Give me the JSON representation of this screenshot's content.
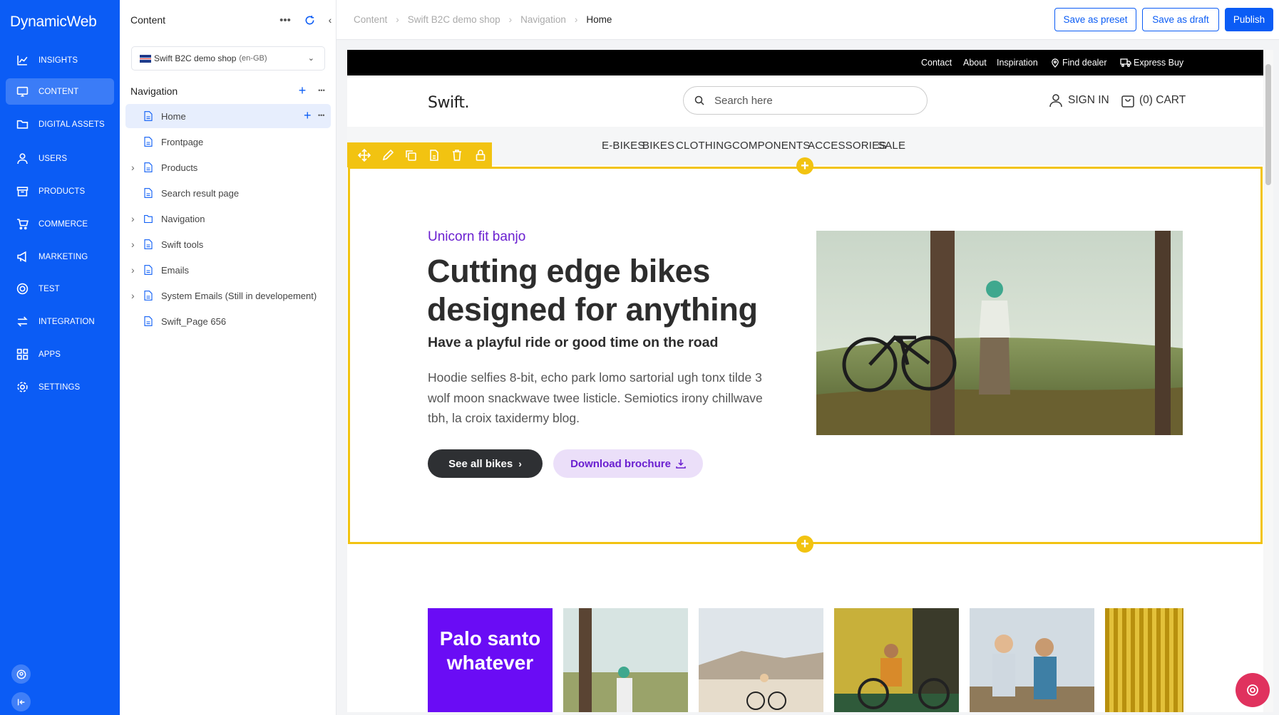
{
  "app": {
    "brand": "DynamicWeb"
  },
  "nav": {
    "items": [
      {
        "label": "INSIGHTS",
        "icon": "chart-line-icon"
      },
      {
        "label": "CONTENT",
        "icon": "monitor-icon"
      },
      {
        "label": "DIGITAL ASSETS",
        "icon": "folder-icon"
      },
      {
        "label": "USERS",
        "icon": "user-icon"
      },
      {
        "label": "PRODUCTS",
        "icon": "box-icon"
      },
      {
        "label": "COMMERCE",
        "icon": "cart-icon"
      },
      {
        "label": "MARKETING",
        "icon": "megaphone-icon"
      },
      {
        "label": "TEST",
        "icon": "target-icon"
      },
      {
        "label": "INTEGRATION",
        "icon": "arrows-icon"
      },
      {
        "label": "APPS",
        "icon": "grid-icon"
      },
      {
        "label": "SETTINGS",
        "icon": "gear-icon"
      }
    ],
    "active": "CONTENT"
  },
  "tree": {
    "title": "Content",
    "area": {
      "name": "Swift B2C demo shop",
      "locale": "(en-GB)"
    },
    "section": "Navigation",
    "rows": [
      {
        "label": "Home",
        "expandable": false,
        "selected": true,
        "type": "page"
      },
      {
        "label": "Frontpage",
        "expandable": false,
        "type": "page"
      },
      {
        "label": "Products",
        "expandable": true,
        "type": "page"
      },
      {
        "label": "Search result page",
        "expandable": false,
        "type": "page"
      },
      {
        "label": "Navigation",
        "expandable": true,
        "type": "folder"
      },
      {
        "label": "Swift tools",
        "expandable": true,
        "type": "page"
      },
      {
        "label": "Emails",
        "expandable": true,
        "type": "page"
      },
      {
        "label": "System Emails (Still in developement)",
        "expandable": true,
        "type": "page"
      },
      {
        "label": "Swift_Page 656",
        "expandable": false,
        "type": "page"
      }
    ]
  },
  "topbar": {
    "breadcrumb": [
      "Content",
      "Swift B2C demo shop",
      "Navigation",
      "Home"
    ],
    "buttons": {
      "preset": "Save as preset",
      "draft": "Save as draft",
      "publish": "Publish"
    }
  },
  "site": {
    "utility_links": [
      "Contact",
      "About",
      "Inspiration",
      "Find dealer",
      "Express Buy"
    ],
    "logo": "Swift.",
    "search_placeholder": "Search here",
    "sign_in": "SIGN IN",
    "cart": "(0) CART",
    "menu": [
      "E-BIKES",
      "BIKES",
      "CLOTHING",
      "COMPONENTS",
      "ACCESSORIES",
      "SALE"
    ],
    "hero": {
      "eyebrow": "Unicorn fit banjo",
      "title": "Cutting edge bikes designed for anything",
      "subtitle": "Have a playful ride or good time on the road",
      "body": "Hoodie selfies 8-bit, echo park lomo sartorial ugh tonx tilde 3 wolf moon snackwave twee listicle. Semiotics irony chillwave tbh, la croix taxidermy blog.",
      "cta_primary": "See all bikes",
      "cta_secondary": "Download brochure"
    },
    "tiles": {
      "first_text": "Palo santo whatever"
    }
  },
  "colors": {
    "brand": "#0b5cf5",
    "accent": "#f2c311",
    "purple": "#6a1fd0"
  }
}
